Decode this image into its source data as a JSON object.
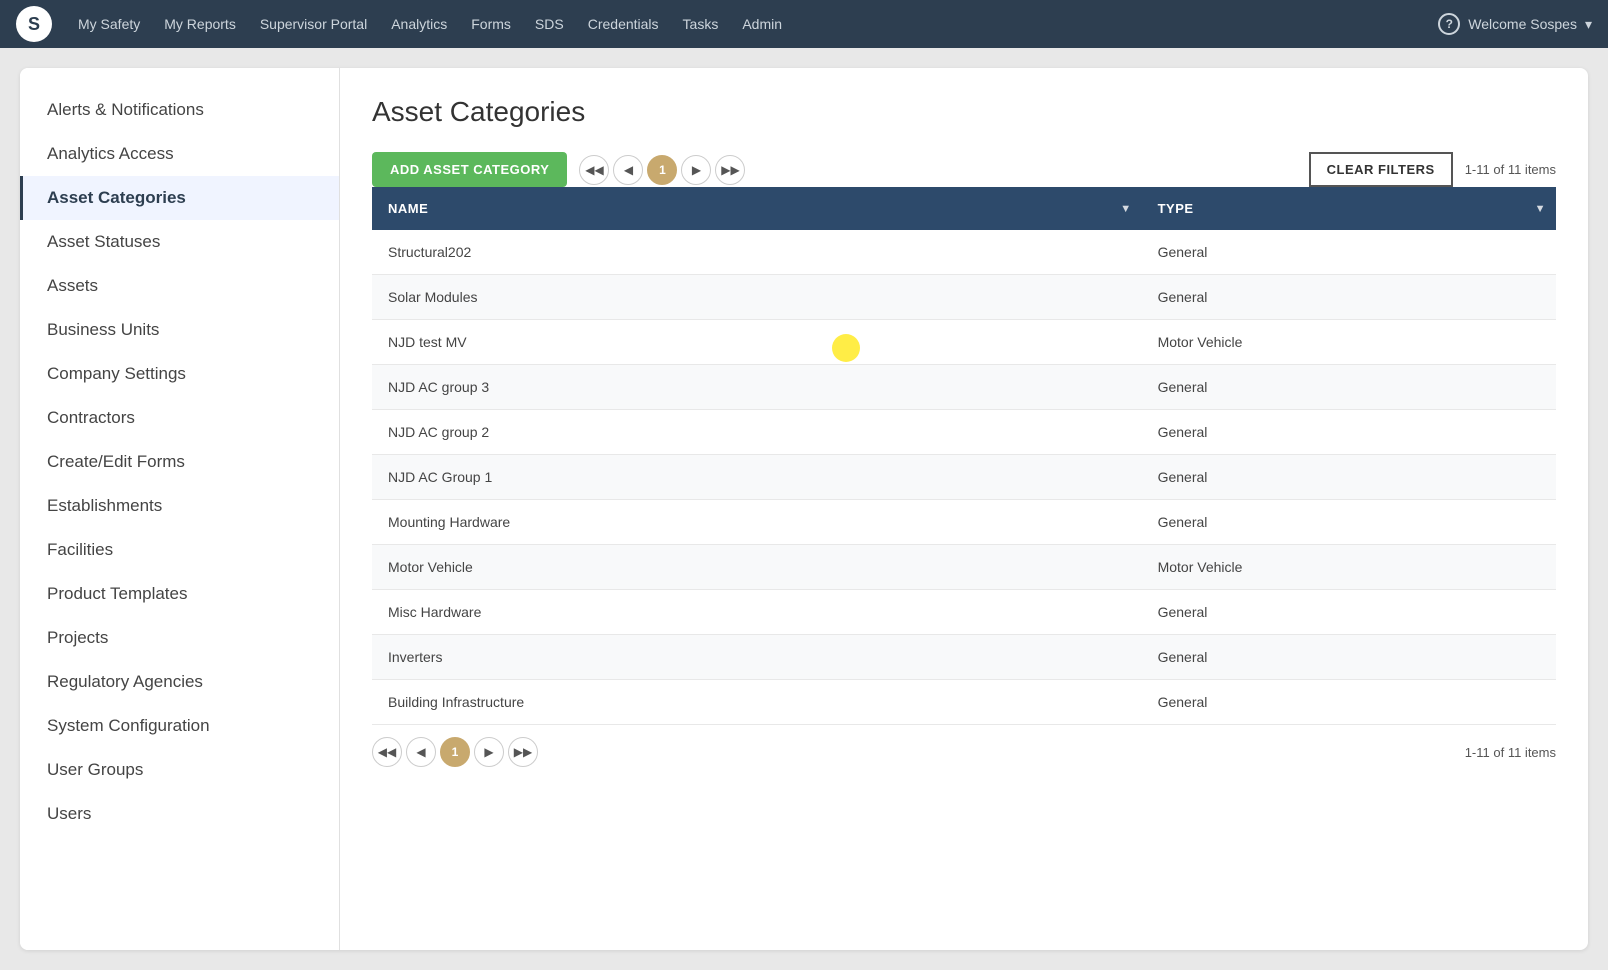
{
  "nav": {
    "logo_letter": "S",
    "links": [
      "My Safety",
      "My Reports",
      "Supervisor Portal",
      "Analytics",
      "Forms",
      "SDS",
      "Credentials",
      "Tasks",
      "Admin"
    ],
    "welcome": "Welcome Sospes",
    "help_icon": "?"
  },
  "sidebar": {
    "items": [
      {
        "label": "Alerts & Notifications",
        "active": false
      },
      {
        "label": "Analytics Access",
        "active": false
      },
      {
        "label": "Asset Categories",
        "active": true
      },
      {
        "label": "Asset Statuses",
        "active": false
      },
      {
        "label": "Assets",
        "active": false
      },
      {
        "label": "Business Units",
        "active": false
      },
      {
        "label": "Company Settings",
        "active": false
      },
      {
        "label": "Contractors",
        "active": false
      },
      {
        "label": "Create/Edit Forms",
        "active": false
      },
      {
        "label": "Establishments",
        "active": false
      },
      {
        "label": "Facilities",
        "active": false
      },
      {
        "label": "Product Templates",
        "active": false
      },
      {
        "label": "Projects",
        "active": false
      },
      {
        "label": "Regulatory Agencies",
        "active": false
      },
      {
        "label": "System Configuration",
        "active": false
      },
      {
        "label": "User Groups",
        "active": false
      },
      {
        "label": "Users",
        "active": false
      }
    ]
  },
  "content": {
    "title": "Asset Categories",
    "toolbar": {
      "add_button": "ADD ASSET CATEGORY",
      "clear_filters_button": "CLEAR FILTERS",
      "items_count": "1-11 of 11 items",
      "page_number": "1"
    },
    "table": {
      "columns": [
        {
          "label": "NAME",
          "has_filter": true
        },
        {
          "label": "TYPE",
          "has_filter": true
        }
      ],
      "rows": [
        {
          "name": "Structural202",
          "type": "General"
        },
        {
          "name": "Solar Modules",
          "type": "General"
        },
        {
          "name": "NJD test MV",
          "type": "Motor Vehicle"
        },
        {
          "name": "NJD AC group 3",
          "type": "General"
        },
        {
          "name": "NJD AC group 2",
          "type": "General"
        },
        {
          "name": "NJD AC Group 1",
          "type": "General"
        },
        {
          "name": "Mounting Hardware",
          "type": "General"
        },
        {
          "name": "Motor Vehicle",
          "type": "Motor Vehicle"
        },
        {
          "name": "Misc Hardware",
          "type": "General"
        },
        {
          "name": "Inverters",
          "type": "General"
        },
        {
          "name": "Building Infrastructure",
          "type": "General"
        }
      ]
    },
    "bottom_pagination": {
      "items_count": "1-11 of 11 items",
      "page_number": "1"
    }
  }
}
